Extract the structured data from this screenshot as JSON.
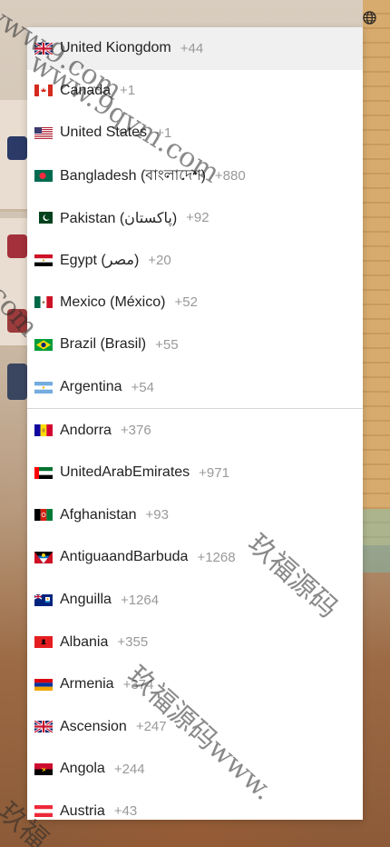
{
  "watermark": {
    "url_a": "www.9.com",
    "url_b": "www.9qym.com",
    "url_c": ".com",
    "cn": "玖福源码www.",
    "cn_b": "玖福源码",
    "cn_c": "玖福"
  },
  "colors": {
    "selected_bg": "#f0f0f0",
    "dial_text": "#999999"
  },
  "countries_top": [
    {
      "name": "United Kiongdom",
      "dial": "+44",
      "flag": "uk",
      "selected": true
    },
    {
      "name": "Canada",
      "dial": "+1",
      "flag": "canada"
    },
    {
      "name": "United States",
      "dial": "+1",
      "flag": "usa"
    },
    {
      "name": "Bangladesh (বাংলাদেশ)",
      "dial": "+880",
      "flag": "bangladesh"
    },
    {
      "name": "Pakistan (پاکستان)",
      "dial": "+92",
      "flag": "pakistan"
    },
    {
      "name": "Egypt (مصر)",
      "dial": "+20",
      "flag": "egypt"
    },
    {
      "name": "Mexico (México)",
      "dial": "+52",
      "flag": "mexico"
    },
    {
      "name": "Brazil (Brasil)",
      "dial": "+55",
      "flag": "brazil"
    },
    {
      "name": "Argentina",
      "dial": "+54",
      "flag": "argentina"
    }
  ],
  "countries_all": [
    {
      "name": "Andorra",
      "dial": "+376",
      "flag": "andorra"
    },
    {
      "name": "UnitedArabEmirates",
      "dial": "+971",
      "flag": "uae"
    },
    {
      "name": "Afghanistan",
      "dial": "+93",
      "flag": "afghanistan"
    },
    {
      "name": "AntiguaandBarbuda",
      "dial": "+1268",
      "flag": "antigua"
    },
    {
      "name": "Anguilla",
      "dial": "+1264",
      "flag": "anguilla"
    },
    {
      "name": "Albania",
      "dial": "+355",
      "flag": "albania"
    },
    {
      "name": "Armenia",
      "dial": "+374",
      "flag": "armenia"
    },
    {
      "name": "Ascension",
      "dial": "+247",
      "flag": "ascension"
    },
    {
      "name": "Angola",
      "dial": "+244",
      "flag": "angola"
    },
    {
      "name": "Austria",
      "dial": "+43",
      "flag": "austria"
    }
  ]
}
